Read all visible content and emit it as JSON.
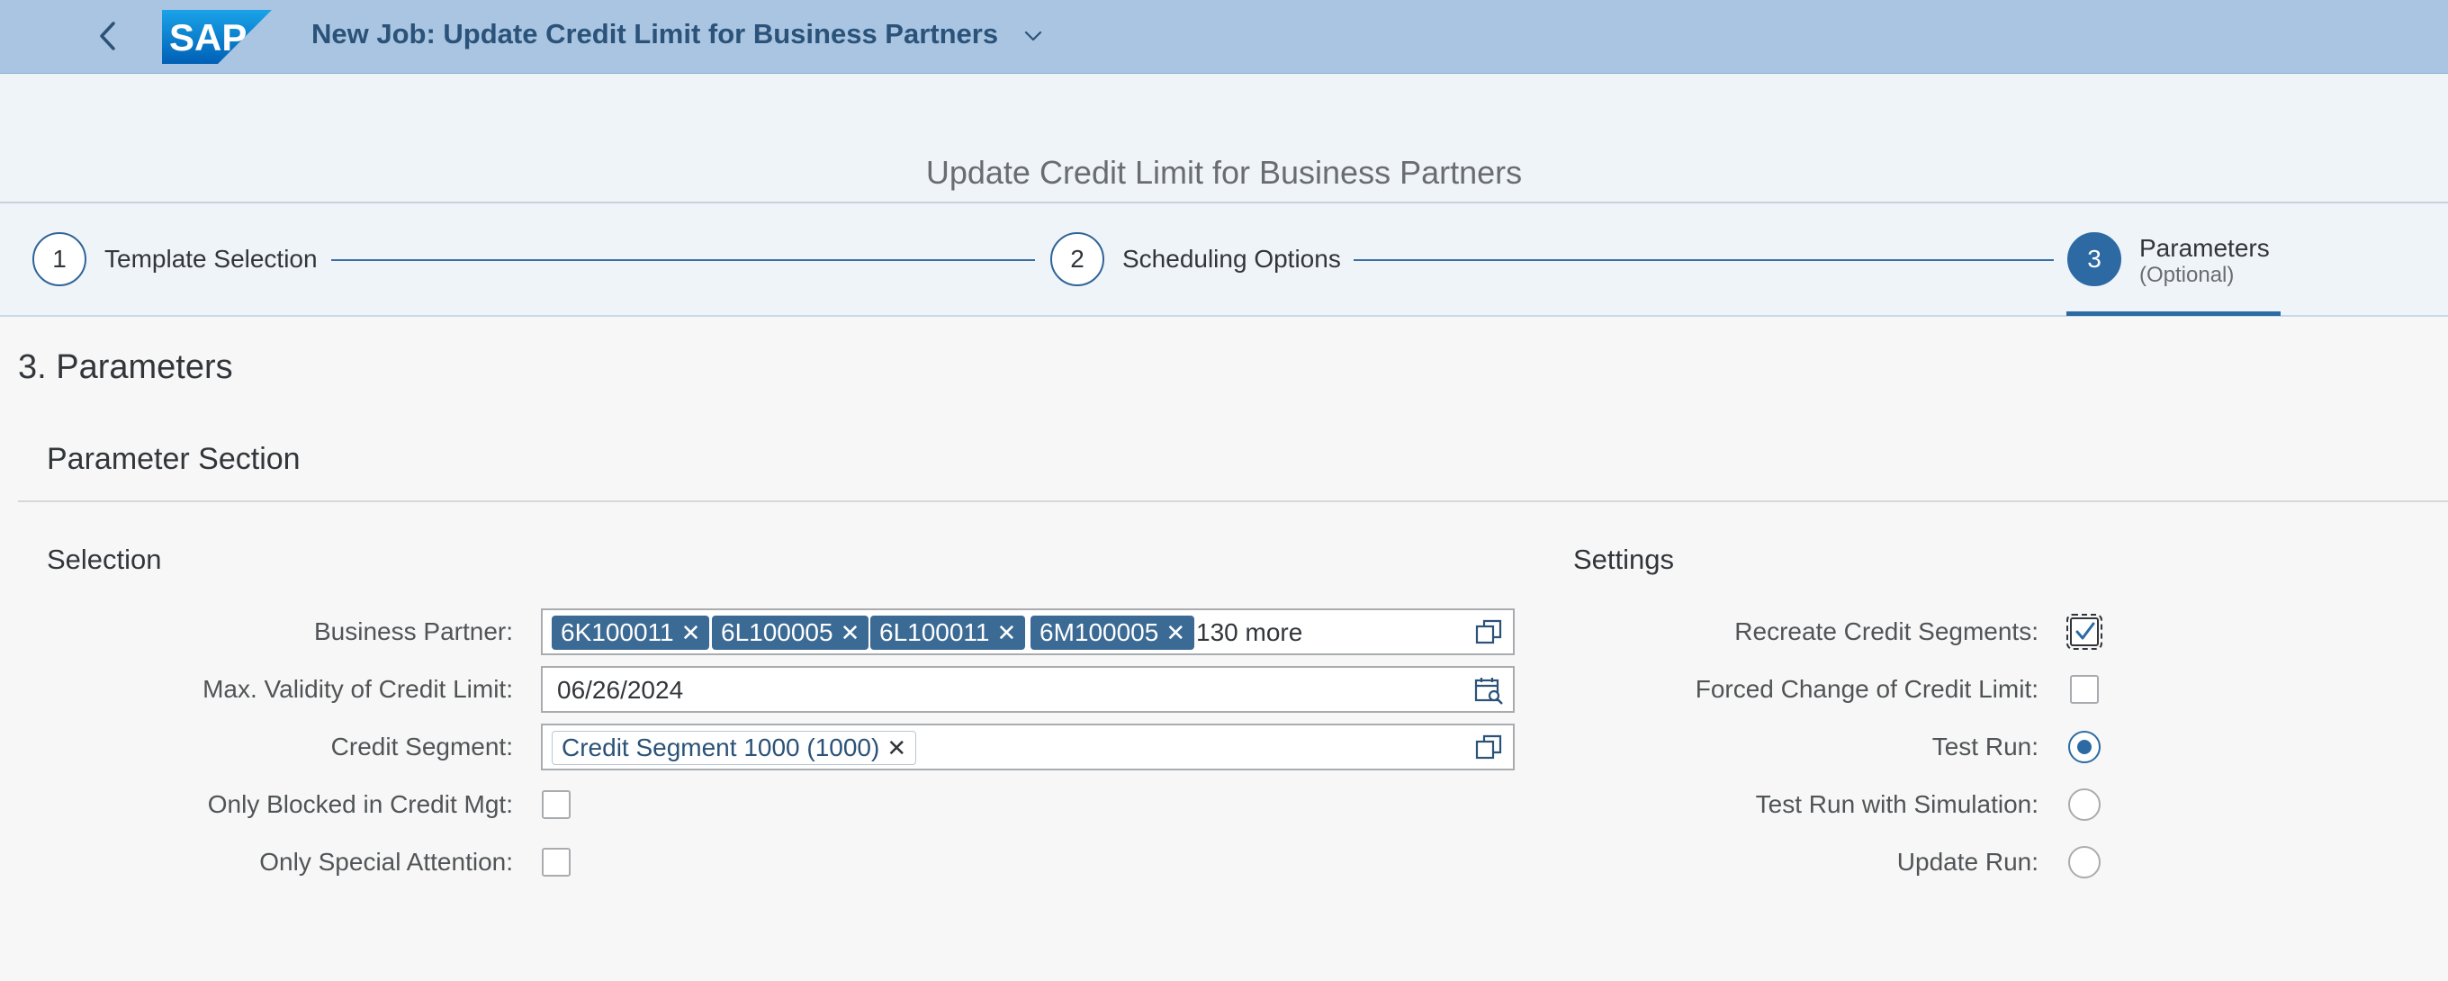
{
  "shell": {
    "title": "New Job: Update Credit Limit for Business Partners",
    "logo_text": "SAP"
  },
  "wizard": {
    "title": "Update Credit Limit for Business Partners",
    "steps": [
      {
        "number": "1",
        "label": "Template Selection"
      },
      {
        "number": "2",
        "label": "Scheduling Options"
      },
      {
        "number": "3",
        "label": "Parameters",
        "sublabel": "(Optional)"
      }
    ],
    "active_step": 3
  },
  "content": {
    "heading": "3. Parameters",
    "panel_title": "Parameter Section",
    "selection": {
      "title": "Selection",
      "business_partner": {
        "label": "Business Partner:",
        "tokens": [
          "6K100011",
          "6L100005",
          "6L100011",
          "6M100005"
        ],
        "more_text": "130 more"
      },
      "max_validity": {
        "label": "Max. Validity of Credit Limit:",
        "value": "06/26/2024"
      },
      "credit_segment": {
        "label": "Credit Segment:",
        "tokens": [
          "Credit Segment 1000 (1000)"
        ]
      },
      "only_blocked": {
        "label": "Only Blocked in Credit Mgt:",
        "checked": false
      },
      "only_special": {
        "label": "Only Special Attention:",
        "checked": false
      }
    },
    "settings": {
      "title": "Settings",
      "recreate_segments": {
        "label": "Recreate Credit Segments:",
        "checked": true
      },
      "forced_change": {
        "label": "Forced Change of Credit Limit:",
        "checked": false
      },
      "test_run": {
        "label": "Test Run:",
        "selected": true
      },
      "test_run_sim": {
        "label": "Test Run with Simulation:",
        "selected": false
      },
      "update_run": {
        "label": "Update Run:",
        "selected": false
      }
    }
  },
  "colors": {
    "shell_bg": "#a9c5e2",
    "accent": "#2d6aa3",
    "token_bg": "#3b6a94"
  }
}
